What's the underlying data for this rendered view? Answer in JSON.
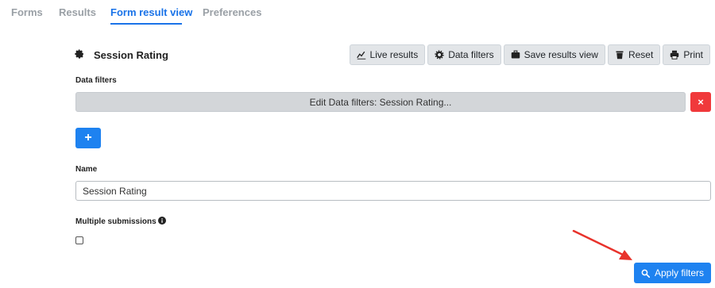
{
  "tabs": [
    {
      "label": "Forms",
      "active": false
    },
    {
      "label": "Results",
      "active": false
    },
    {
      "label": "Form result view",
      "active": true
    },
    {
      "label": "Preferences",
      "active": false
    }
  ],
  "header": {
    "title": "Session Rating",
    "title_icon": "gear-icon"
  },
  "toolbar": {
    "live_results": "Live results",
    "data_filters": "Data filters",
    "save_results_view": "Save results view",
    "reset": "Reset",
    "print": "Print"
  },
  "data_filters": {
    "label": "Data filters",
    "edit_button": "Edit Data filters: Session Rating...",
    "remove_button": "×",
    "add_button": "+"
  },
  "name_field": {
    "label": "Name",
    "value": "Session Rating"
  },
  "multiple_submissions": {
    "label": "Multiple submissions",
    "checked": false
  },
  "apply_button": {
    "label": "Apply filters"
  },
  "colors": {
    "accent": "#1e82f0",
    "danger": "#f0393b",
    "annotation_arrow": "#e8322b"
  }
}
